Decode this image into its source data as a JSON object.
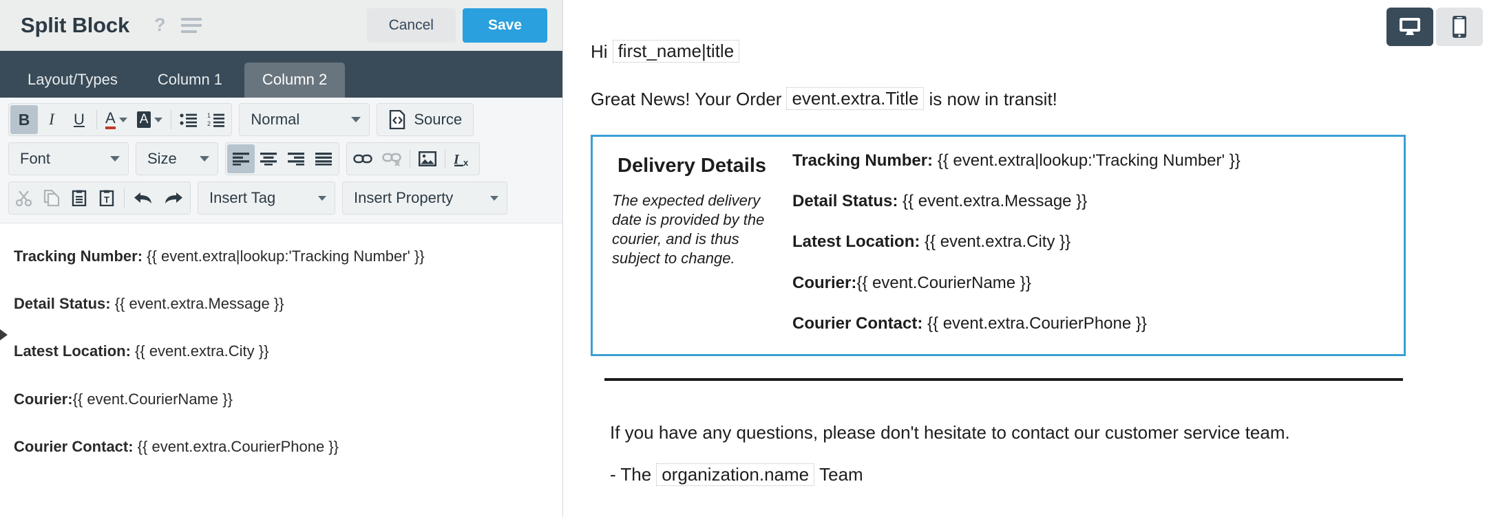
{
  "modal": {
    "title": "Split Block",
    "help_icon": "question-mark-icon",
    "menu_icon": "hamburger-menu-icon",
    "cancel_label": "Cancel",
    "save_label": "Save",
    "accent_color": "#2aa0de",
    "header_bg": "#eceded"
  },
  "tabs": [
    {
      "label": "Layout/Types",
      "active": false
    },
    {
      "label": "Column 1",
      "active": false
    },
    {
      "label": "Column 2",
      "active": true
    }
  ],
  "toolbar": {
    "row1": {
      "buttons": [
        {
          "name": "bold-icon",
          "glyph": "B",
          "active": true
        },
        {
          "name": "italic-icon",
          "glyph": "I",
          "active": false
        },
        {
          "name": "underline-icon",
          "glyph": "U",
          "active": false
        },
        {
          "name": "text-color-icon",
          "glyph": "A",
          "active": false
        },
        {
          "name": "background-color-icon",
          "glyph": "A",
          "active": false
        },
        {
          "name": "bulleted-list-icon",
          "glyph": "•≡",
          "active": false
        },
        {
          "name": "numbered-list-icon",
          "glyph": "1≡",
          "active": false
        }
      ],
      "format_select": "Normal",
      "source_label": "Source"
    },
    "row2": {
      "font_select": "Font",
      "size_select": "Size",
      "align": [
        "align-left-icon",
        "align-center-icon",
        "align-right-icon",
        "align-justify-icon"
      ],
      "align_active": "align-left-icon",
      "link_icon": "link-icon",
      "unlink_icon": "unlink-icon",
      "image_icon": "image-icon",
      "remove_format_icon": "remove-format-icon"
    },
    "row3": {
      "buttons": [
        {
          "name": "cut-icon",
          "disabled": true
        },
        {
          "name": "copy-icon",
          "disabled": true
        },
        {
          "name": "paste-icon",
          "disabled": false
        },
        {
          "name": "paste-as-text-icon",
          "disabled": false
        },
        {
          "name": "undo-icon",
          "disabled": false
        },
        {
          "name": "redo-icon",
          "disabled": false
        }
      ],
      "insert_tag_label": "Insert Tag",
      "insert_property_label": "Insert Property"
    }
  },
  "editor": {
    "lines": [
      {
        "label": "Tracking Number:",
        "value": " {{ event.extra|lookup:'Tracking Number' }}"
      },
      {
        "label": "Detail Status:",
        "value": " {{ event.extra.Message }}"
      },
      {
        "label": "Latest Location:",
        "value": " {{ event.extra.City }}"
      },
      {
        "label": "Courier:",
        "value": "{{ event.CourierName }}"
      },
      {
        "label": "Courier Contact:",
        "value": " {{ event.extra.CourierPhone }}"
      }
    ]
  },
  "preview": {
    "device_desktop_icon": "desktop-monitor-icon",
    "device_mobile_icon": "mobile-phone-icon",
    "active_device": "desktop-monitor-icon",
    "greeting_prefix": "Hi",
    "greeting_token": "first_name|title",
    "order_prefix": "Great News! Your Order",
    "order_token": "event.extra.Title",
    "order_suffix": "is now in transit!",
    "details": {
      "border_color": "#3a9fd4",
      "title": "Delivery Details",
      "note": "The expected delivery date is provided by the courier, and is thus subject to change.",
      "rows": [
        {
          "label": "Tracking Number:",
          "value": " {{ event.extra|lookup:'Tracking Number' }}"
        },
        {
          "label": "Detail Status:",
          "value": " {{ event.extra.Message }}"
        },
        {
          "label": "Latest Location:",
          "value": " {{ event.extra.City }}"
        },
        {
          "label": "Courier:",
          "value": "{{ event.CourierName }}"
        },
        {
          "label": "Courier Contact:",
          "value": " {{ event.extra.CourierPhone }}"
        }
      ]
    },
    "closing_text": "If you have any questions, please don't hesitate to contact our customer service team.",
    "signoff_prefix": "- The",
    "signoff_token": "organization.name",
    "signoff_suffix": "Team"
  }
}
